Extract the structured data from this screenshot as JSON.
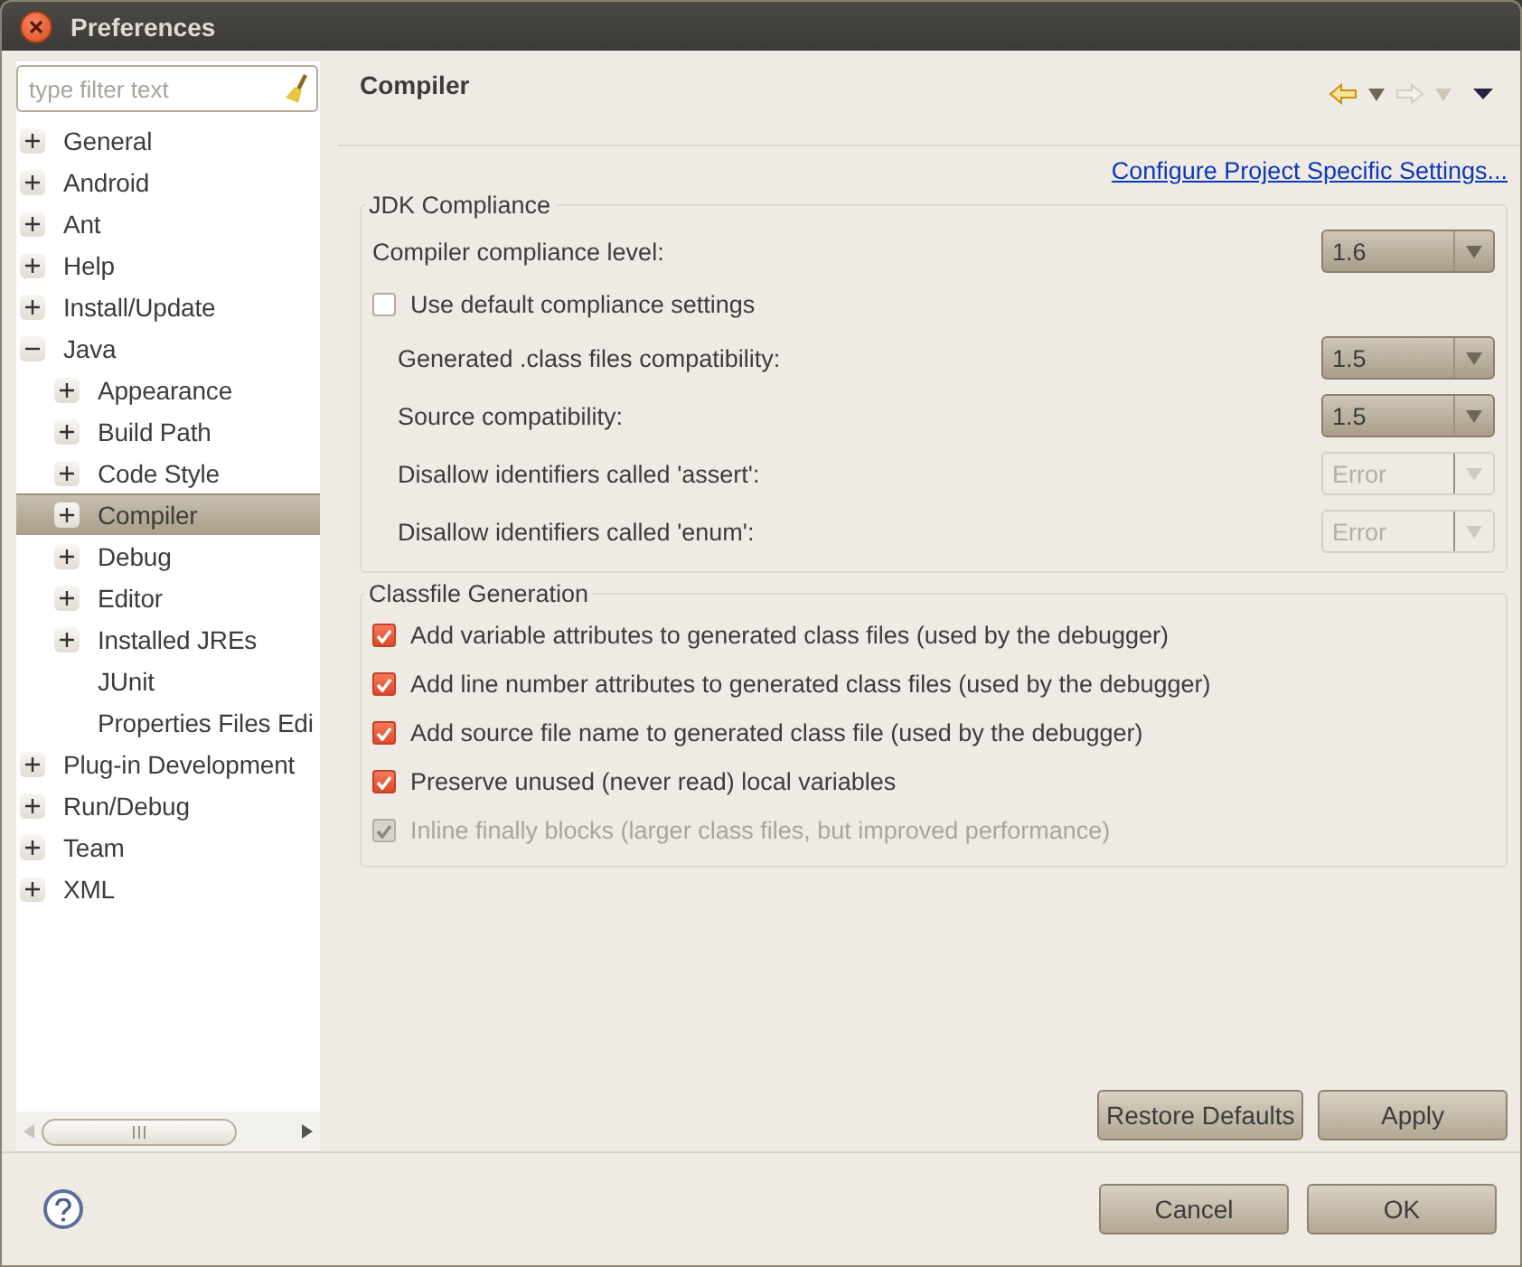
{
  "window": {
    "title": "Preferences"
  },
  "filter": {
    "placeholder": "type filter text"
  },
  "tree": [
    {
      "label": "General",
      "expanded": false,
      "selected": false
    },
    {
      "label": "Android",
      "expanded": false,
      "selected": false
    },
    {
      "label": "Ant",
      "expanded": false,
      "selected": false
    },
    {
      "label": "Help",
      "expanded": false,
      "selected": false
    },
    {
      "label": "Install/Update",
      "expanded": false,
      "selected": false
    },
    {
      "label": "Java",
      "expanded": true,
      "selected": false,
      "children": [
        {
          "label": "Appearance",
          "expanded": false,
          "selected": false
        },
        {
          "label": "Build Path",
          "expanded": false,
          "selected": false
        },
        {
          "label": "Code Style",
          "expanded": false,
          "selected": false
        },
        {
          "label": "Compiler",
          "expanded": false,
          "selected": true
        },
        {
          "label": "Debug",
          "expanded": false,
          "selected": false
        },
        {
          "label": "Editor",
          "expanded": false,
          "selected": false
        },
        {
          "label": "Installed JREs",
          "expanded": false,
          "selected": false
        },
        {
          "label": "JUnit",
          "selected": false
        },
        {
          "label": "Properties Files Edi",
          "selected": false
        }
      ]
    },
    {
      "label": "Plug-in Development",
      "expanded": false,
      "selected": false
    },
    {
      "label": "Run/Debug",
      "expanded": false,
      "selected": false
    },
    {
      "label": "Team",
      "expanded": false,
      "selected": false
    },
    {
      "label": "XML",
      "expanded": false,
      "selected": false
    }
  ],
  "page": {
    "title": "Compiler",
    "link": "Configure Project Specific Settings...",
    "jdk": {
      "title": "JDK Compliance",
      "compliance": {
        "label": "Compiler compliance level:",
        "value": "1.6",
        "disabled": false
      },
      "use_default": {
        "label": "Use default compliance settings",
        "checked": false,
        "disabled": false
      },
      "settings": [
        {
          "label": "Generated .class files compatibility:",
          "value": "1.5",
          "disabled": false
        },
        {
          "label": "Source compatibility:",
          "value": "1.5",
          "disabled": false
        },
        {
          "label": "Disallow identifiers called 'assert':",
          "value": "Error",
          "disabled": true
        },
        {
          "label": "Disallow identifiers called 'enum':",
          "value": "Error",
          "disabled": true
        }
      ]
    },
    "classfile": {
      "title": "Classfile Generation",
      "options": [
        {
          "label": "Add variable attributes to generated class files (used by the debugger)",
          "checked": true,
          "disabled": false
        },
        {
          "label": "Add line number attributes to generated class files (used by the debugger)",
          "checked": true,
          "disabled": false
        },
        {
          "label": "Add source file name to generated class file (used by the debugger)",
          "checked": true,
          "disabled": false
        },
        {
          "label": "Preserve unused (never read) local variables",
          "checked": true,
          "disabled": false
        },
        {
          "label": "Inline finally blocks (larger class files, but improved performance)",
          "checked": true,
          "disabled": true
        }
      ]
    },
    "buttons": [
      "Restore Defaults",
      "Apply"
    ]
  },
  "footer": {
    "buttons": [
      "Cancel",
      "OK"
    ]
  }
}
